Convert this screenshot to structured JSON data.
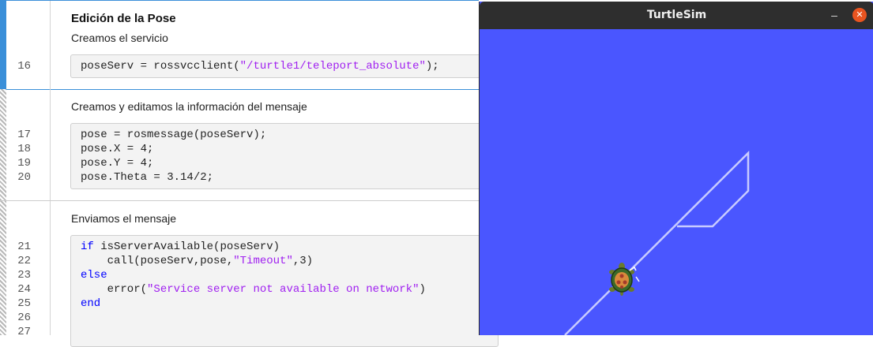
{
  "live_script": {
    "sections": [
      {
        "heading": "Edición de la Pose",
        "text": "Creamos el servicio",
        "lines": [
          {
            "num": "16",
            "code": "poseServ = rossvcclient(\"/turtle1/teleport_absolute\");"
          }
        ]
      },
      {
        "text": "Creamos y editamos la información del mensaje",
        "lines": [
          {
            "num": "17",
            "code": "pose = rosmessage(poseServ);"
          },
          {
            "num": "18",
            "code": "pose.X = 4;"
          },
          {
            "num": "19",
            "code": "pose.Y = 4;"
          },
          {
            "num": "20",
            "code": "pose.Theta = 3.14/2;"
          }
        ]
      },
      {
        "text": "Enviamos el mensaje",
        "lines": [
          {
            "num": "21",
            "code": "if isServerAvailable(poseServ)"
          },
          {
            "num": "22",
            "code": "    call(poseServ,pose,\"Timeout\",3)"
          },
          {
            "num": "23",
            "code": "else"
          },
          {
            "num": "24",
            "code": "    error(\"Service server not available on network\")"
          },
          {
            "num": "25",
            "code": "end"
          },
          {
            "num": "26",
            "code": ""
          },
          {
            "num": "27",
            "code": ""
          }
        ]
      }
    ]
  },
  "turtlesim": {
    "title": "TurtleSim",
    "minimize_icon": "minimize-icon",
    "close_icon": "close-icon",
    "background_color": "#4a56ff",
    "path_color": "#c8cbff",
    "turtle_icon": "turtle-icon"
  }
}
